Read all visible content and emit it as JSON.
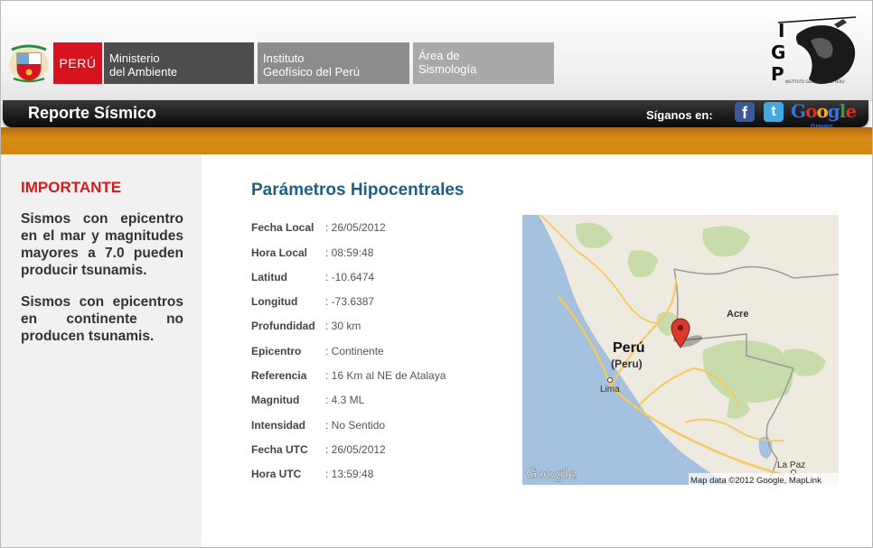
{
  "header": {
    "peru_label": "PERÚ",
    "orgs": [
      {
        "line1": "Ministerio",
        "line2": "del Ambiente"
      },
      {
        "line1": "Instituto",
        "line2": "Geofísico del Perú"
      },
      {
        "line1": "Área de",
        "line2": "Sismología"
      }
    ],
    "logo_letters": [
      "I",
      "G",
      "P"
    ],
    "logo_caption": "INSTITUTO GEOFÍSICO DEL PERÚ"
  },
  "titlebar": {
    "title": "Reporte Sísmico",
    "follow_label": "Síganos en:",
    "social": [
      {
        "name": "facebook",
        "glyph": "f"
      },
      {
        "name": "twitter",
        "glyph": "t"
      },
      {
        "name": "google-groups",
        "text": "Google",
        "sub": "Groups"
      }
    ]
  },
  "sidebar": {
    "heading": "IMPORTANTE",
    "para1": "Sismos con epicentro en el mar y magnitudes mayores a 7.0 pueden producir tsunamis.",
    "para2": "Sismos con epicentros en continente no producen tsunamis."
  },
  "main": {
    "title": "Parámetros Hipocentrales",
    "params": [
      {
        "label": "Fecha Local",
        "value": ": 26/05/2012"
      },
      {
        "label": "Hora Local",
        "value": ": 08:59:48"
      },
      {
        "label": "Latitud",
        "value": ": -10.6474"
      },
      {
        "label": "Longitud",
        "value": ": -73.6387"
      },
      {
        "label": "Profundidad",
        "value": ": 30 km"
      },
      {
        "label": "Epicentro",
        "value": ": Continente"
      },
      {
        "label": "Referencia",
        "value": ": 16 Km al NE de Atalaya"
      },
      {
        "label": "Magnitud",
        "value": ": 4.3 ML"
      },
      {
        "label": "Intensidad",
        "value": ": No Sentido"
      },
      {
        "label": "Fecha UTC",
        "value": ": 26/05/2012"
      },
      {
        "label": "Hora UTC",
        "value": ": 13:59:48"
      }
    ]
  },
  "map": {
    "country": "Perú",
    "country_sub": "(Peru)",
    "labels": [
      "Acre",
      "Lima",
      "La Paz"
    ],
    "google_logo": "Google",
    "attribution": "Map data ©2012 Google, MapLink",
    "colors": {
      "ocean": "#a4c1e0",
      "land": "#eeeae0",
      "park": "#c7dcaa",
      "road": "#f5c95e",
      "marker": "#d93a2c"
    }
  }
}
